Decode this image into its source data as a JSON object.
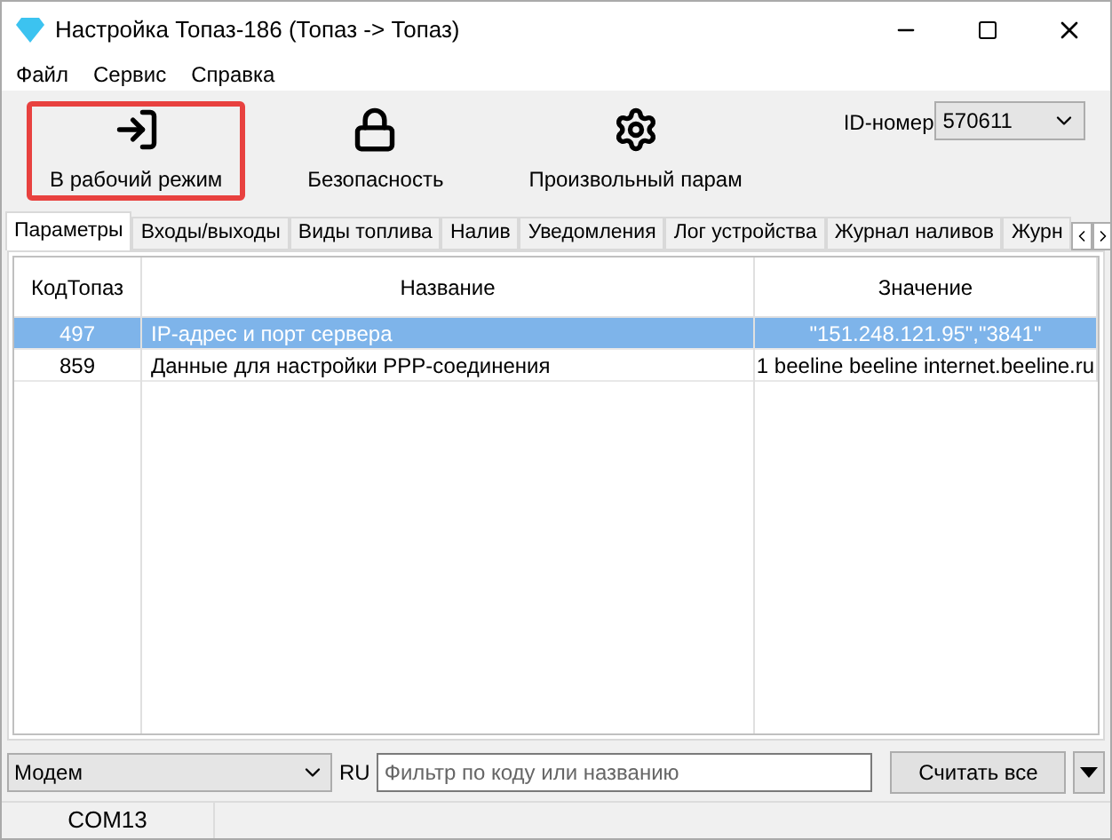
{
  "window": {
    "title": "Настройка Топаз-186 (Топаз -> Топаз)"
  },
  "menu": [
    "Файл",
    "Сервис",
    "Справка"
  ],
  "toolbar": [
    {
      "kind": "exit",
      "label": "В рабочий режим",
      "highlighted": true
    },
    {
      "kind": "lock",
      "label": "Безопасность",
      "highlighted": false
    },
    {
      "kind": "gear",
      "label": "Произвольный парам",
      "highlighted": false
    }
  ],
  "id_field": {
    "label": "ID-номер",
    "value": "570611"
  },
  "tabs": [
    {
      "label": "Параметры",
      "selected": true
    },
    {
      "label": "Входы/выходы",
      "selected": false
    },
    {
      "label": "Виды топлива",
      "selected": false
    },
    {
      "label": "Налив",
      "selected": false
    },
    {
      "label": "Уведомления",
      "selected": false
    },
    {
      "label": "Лог устройства",
      "selected": false
    },
    {
      "label": "Журнал наливов",
      "selected": false
    },
    {
      "label": "Журн",
      "selected": false
    }
  ],
  "table": {
    "columns": [
      "КодТопаз",
      "Название",
      "Значение"
    ],
    "rows": [
      {
        "cells": [
          "497",
          "IP-адрес и порт сервера",
          "\"151.248.121.95\",\"3841\""
        ],
        "selected": true
      },
      {
        "cells": [
          "859",
          "Данные для настройки PPP-соединения",
          "1 beeline beeline internet.beeline.ru"
        ],
        "selected": false
      }
    ]
  },
  "bottom": {
    "mode": "Модем",
    "lang": "RU",
    "filter_placeholder": "Фильтр по коду или названию",
    "read_button": "Считать все"
  },
  "status_bar": [
    "COM13"
  ]
}
